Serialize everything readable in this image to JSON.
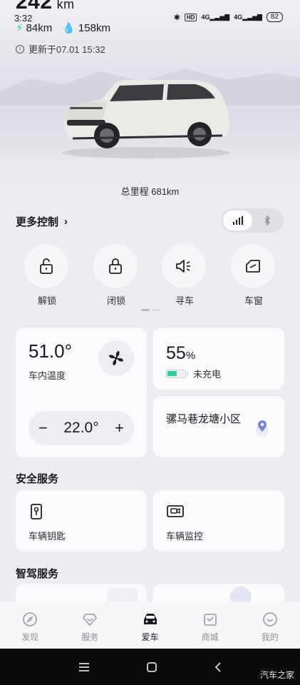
{
  "status_bar": {
    "time": "3:32",
    "hd": "HD",
    "sig1": "4G",
    "sig2": "4G",
    "battery": "82"
  },
  "hero": {
    "range_value": "242",
    "range_unit": "km",
    "electric_range": "84km",
    "fuel_range": "158km",
    "updated": "更新于07.01 15:32",
    "total_mileage": "总里程 681km"
  },
  "controls": {
    "more_label": "更多控制",
    "items": [
      {
        "label": "解锁",
        "icon": "unlock-icon"
      },
      {
        "label": "闭锁",
        "icon": "lock-icon"
      },
      {
        "label": "寻车",
        "icon": "find-car-icon"
      },
      {
        "label": "车窗",
        "icon": "window-icon"
      }
    ],
    "connection_modes": [
      "signal-icon",
      "bluetooth-icon"
    ]
  },
  "climate": {
    "interior_temp": "51.0°",
    "interior_label": "车内温度",
    "set_temp": "22.0°"
  },
  "battery": {
    "percent": "55",
    "percent_sign": "%",
    "charge_status": "未充电",
    "level": 0.55
  },
  "location": {
    "address": "骡马巷龙塘小区"
  },
  "safety": {
    "title": "安全服务",
    "items": [
      {
        "label": "车辆钥匙",
        "icon": "car-key-icon"
      },
      {
        "label": "车辆监控",
        "icon": "camera-monitor-icon"
      }
    ]
  },
  "driving": {
    "title": "智驾服务"
  },
  "tabbar": {
    "items": [
      {
        "label": "发现",
        "icon": "compass-icon"
      },
      {
        "label": "服务",
        "icon": "diamond-icon"
      },
      {
        "label": "爱车",
        "icon": "car-icon"
      },
      {
        "label": "商城",
        "icon": "shop-icon"
      },
      {
        "label": "我的",
        "icon": "profile-icon"
      }
    ],
    "active": "爱车"
  },
  "watermark": "汽车之家",
  "colors": {
    "accent_green": "#2bd19c",
    "location_pin": "#7b86d6",
    "background": "#ecedf2"
  }
}
